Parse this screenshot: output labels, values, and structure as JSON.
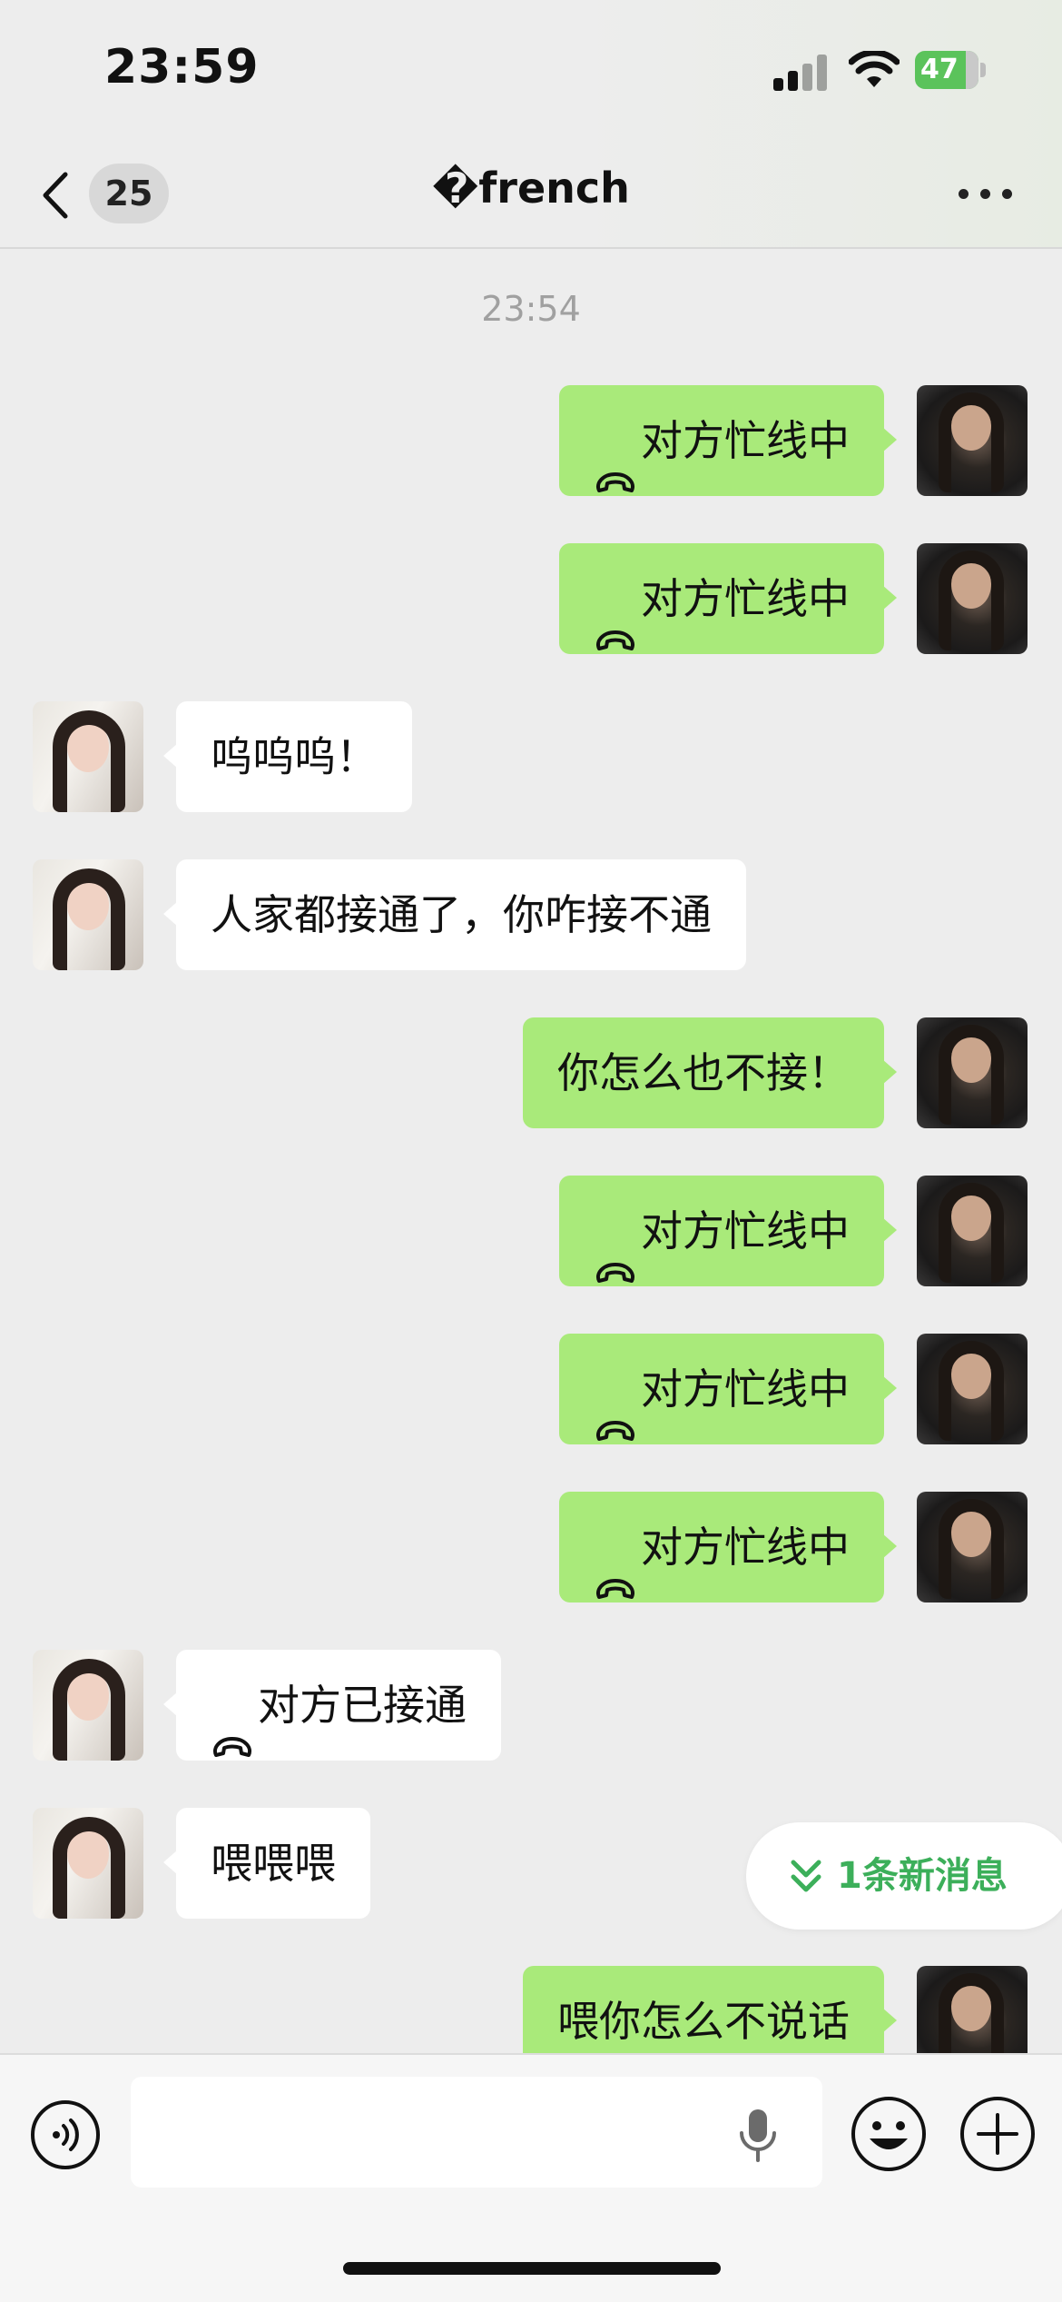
{
  "status_bar": {
    "time": "23:59",
    "battery": "47"
  },
  "nav": {
    "back_count": "25",
    "title": "�french"
  },
  "chat": {
    "timestamp": "23:54",
    "messages": [
      {
        "from": "self",
        "text": "对方忙线中",
        "call": true
      },
      {
        "from": "self",
        "text": "对方忙线中",
        "call": true
      },
      {
        "from": "other",
        "text": "呜呜呜！",
        "call": false
      },
      {
        "from": "other",
        "text": "人家都接通了，你咋接不通",
        "call": false
      },
      {
        "from": "self",
        "text": "你怎么也不接！",
        "call": false
      },
      {
        "from": "self",
        "text": "对方忙线中",
        "call": true
      },
      {
        "from": "self",
        "text": "对方忙线中",
        "call": true
      },
      {
        "from": "self",
        "text": "对方忙线中",
        "call": true
      },
      {
        "from": "other",
        "text": "对方已接通",
        "call": true
      },
      {
        "from": "other",
        "text": "喂喂喂",
        "call": false
      },
      {
        "from": "self",
        "text": "喂你怎么不说话",
        "call": false
      }
    ],
    "new_message_pill": "1条新消息"
  },
  "input": {
    "value": "",
    "placeholder": ""
  },
  "colors": {
    "self_bubble": "#A9EA7A",
    "other_bubble": "#FFFFFF",
    "accent_green": "#3CAF5A",
    "background": "#EDEDED"
  }
}
